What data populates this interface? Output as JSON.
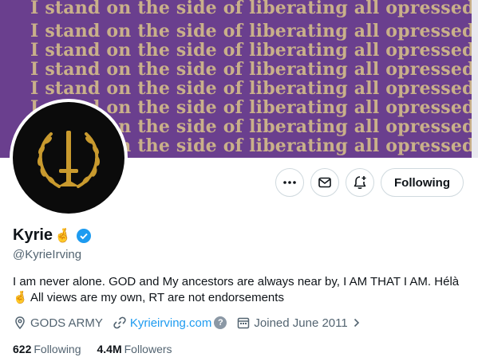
{
  "banner": {
    "line_text": "I stand on the side of liberating all opressed people.",
    "background_color": "#6a3f8e",
    "text_color": "#c9b08a"
  },
  "profile": {
    "display_name": "Kyrie",
    "handle": "@KyrieIrving",
    "bio_line1": "I am never alone. GOD and My ancestors are always near by, I AM THAT I AM. Hélà",
    "bio_line2": "All views are my own, RT are not endorsements",
    "location": "GODS ARMY",
    "website": "Kyrieirving.com",
    "joined": "Joined June 2011"
  },
  "actions": {
    "more_icon": "more-icon",
    "message_icon": "message-icon",
    "notify_icon": "notification-add-icon",
    "follow_label": "Following"
  },
  "stats": {
    "following_count": "622",
    "following_label": "Following",
    "followers_count": "4.4M",
    "followers_label": "Followers"
  },
  "colors": {
    "accent": "#1d9bf0",
    "secondary_text": "#536471"
  }
}
